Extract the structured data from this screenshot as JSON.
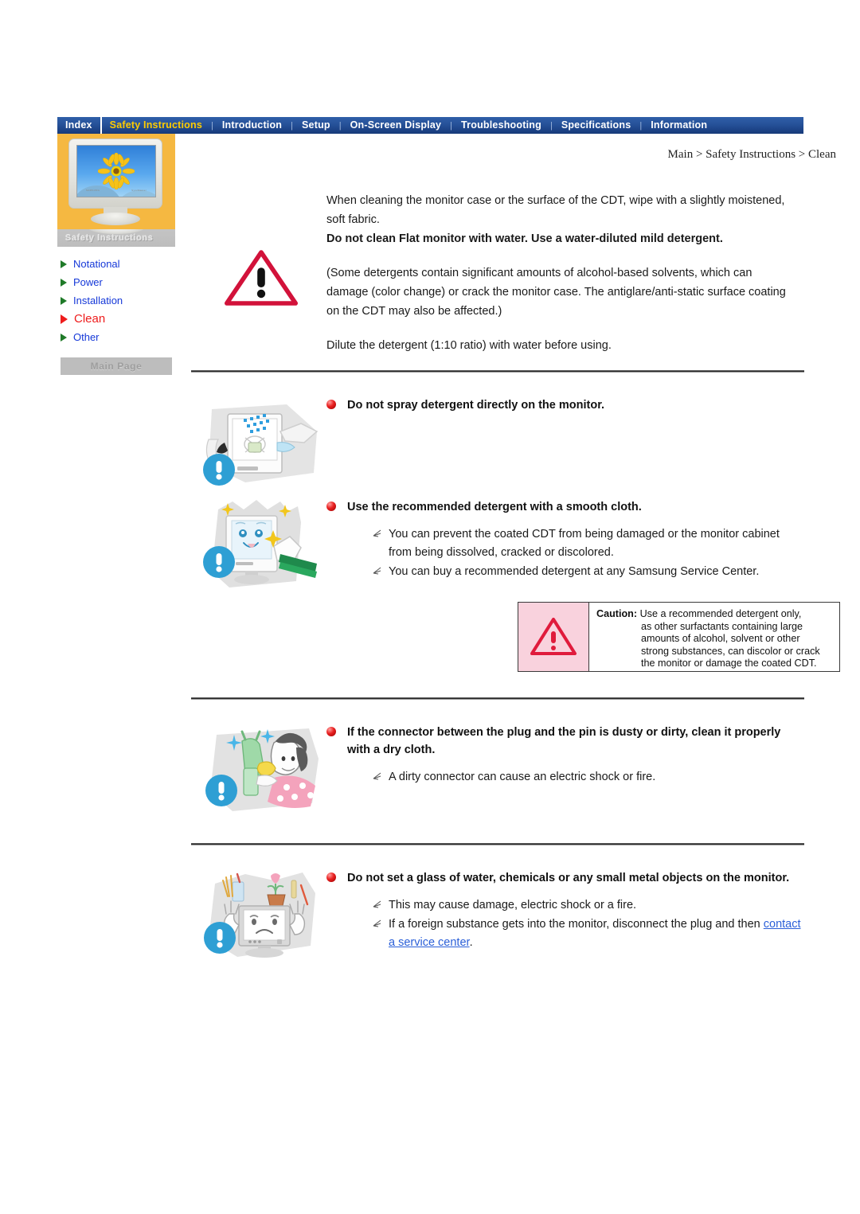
{
  "nav": {
    "items": [
      {
        "label": "Index",
        "active": false
      },
      {
        "label": "Safety Instructions",
        "active": true
      },
      {
        "label": "Introduction",
        "active": false
      },
      {
        "label": "Setup",
        "active": false
      },
      {
        "label": "On-Screen Display",
        "active": false
      },
      {
        "label": "Troubleshooting",
        "active": false
      },
      {
        "label": "Specifications",
        "active": false
      },
      {
        "label": "Information",
        "active": false
      }
    ],
    "separator": "|"
  },
  "sidebar": {
    "banner_title": "Safety Instructions",
    "monitor_brand_left": "SAMSUNG",
    "monitor_brand_right": "SyncMaster",
    "items": [
      {
        "label": "Notational",
        "current": false
      },
      {
        "label": "Power",
        "current": false
      },
      {
        "label": "Installation",
        "current": false
      },
      {
        "label": "Clean",
        "current": true
      },
      {
        "label": "Other",
        "current": false
      }
    ],
    "main_page_label": "Main Page"
  },
  "breadcrumb": "Main > Safety Instructions > Clean",
  "intro": {
    "para1": "When cleaning the monitor case or the surface of the CDT, wipe with a slightly moistened, soft fabric.",
    "bold_line": "Do not clean Flat monitor with water. Use a water-diluted mild detergent.",
    "para2": "(Some detergents contain significant amounts of alcohol-based solvents, which can damage (color change) or crack the monitor case. The antiglare/anti-static surface coating on the CDT may also be affected.)",
    "para3": "Dilute the detergent (1:10 ratio) with water before using."
  },
  "sections": [
    {
      "id": "spray",
      "heading": "Do not spray detergent directly on the monitor.",
      "items": [],
      "illustration": "monitor-spray-illustration",
      "badge": "exclamation-badge"
    },
    {
      "id": "detergent",
      "heading": "Use the recommended detergent with a smooth cloth.",
      "items": [
        "You can prevent the coated CDT from being damaged or the monitor cabinet from being dissolved, cracked or discolored.",
        "You can buy a recommended detergent at any Samsung Service Center."
      ],
      "illustration": "monitor-cleaning-illustration",
      "badge": "exclamation-badge"
    },
    {
      "id": "connector",
      "heading": "If the connector between the plug and the pin is dusty or dirty, clean it properly with a dry cloth.",
      "items": [
        "A dirty connector can cause an electric shock or fire."
      ],
      "illustration": "plug-cleaning-illustration",
      "badge": "exclamation-badge"
    },
    {
      "id": "objects",
      "heading": "Do not set a glass of water, chemicals or any small metal objects on the monitor.",
      "items": [
        "This may cause damage, electric shock or a fire."
      ],
      "illustration": "objects-on-monitor-illustration",
      "badge": "exclamation-badge"
    }
  ],
  "caution": {
    "label": "Caution:",
    "lines": [
      "Use a recommended detergent only,",
      "as other surfactants containing large",
      "amounts of alcohol, solvent or other",
      "strong substances, can discolor or crack",
      "the monitor or damage the coated CDT."
    ]
  },
  "last_item": {
    "prefix": "If a foreign substance gets into the monitor, disconnect the plug and then ",
    "link": "contact a service center",
    "suffix": "."
  },
  "colors": {
    "nav_blue": "#27539b",
    "nav_active_yellow": "#ffcc00",
    "sidebar_orange": "#f5b841",
    "menu_blue": "#1538d8",
    "current_red": "#ee1c1c",
    "bullet_red": "#e81f1f",
    "link_blue": "#2a5fd8",
    "caution_pink": "#f9d2dd",
    "badge_blue": "#2e9fd4"
  }
}
